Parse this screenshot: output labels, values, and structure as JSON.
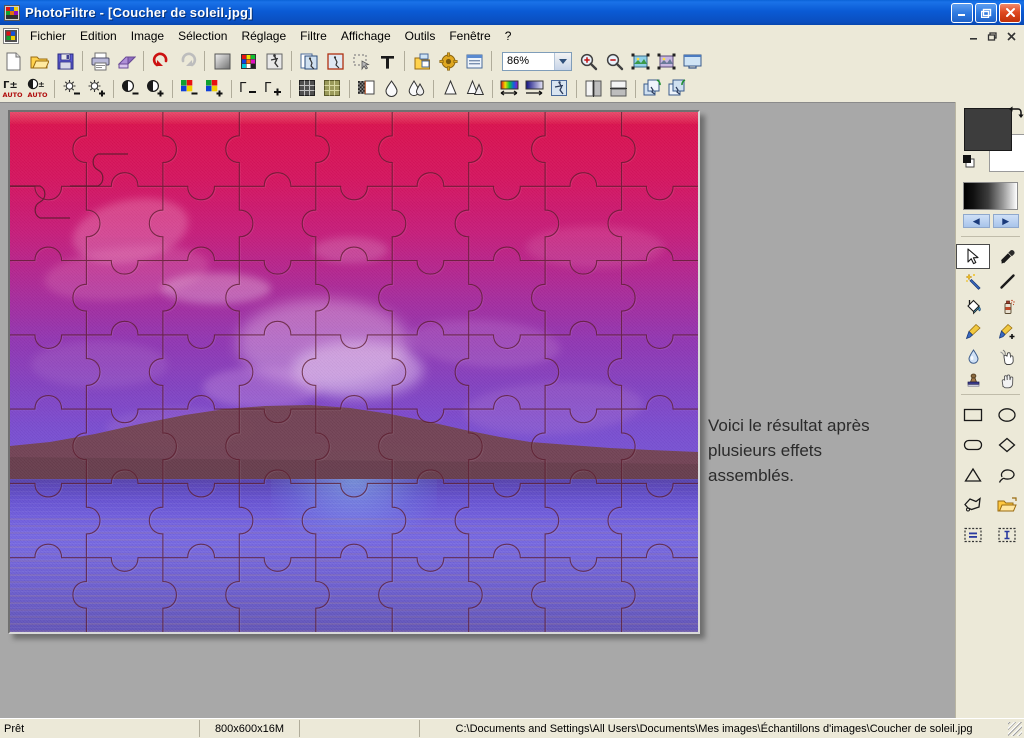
{
  "window": {
    "app_name": "PhotoFiltre",
    "document_name": "Coucher de soleil.jpg",
    "title": "PhotoFiltre - [Coucher de soleil.jpg]",
    "title_icon": "photofiltre-logo-icon",
    "controls": {
      "minimize": "–",
      "maximize": "❐",
      "close": "✕"
    },
    "mdi_controls": {
      "minimize": "–",
      "restore": "❐",
      "close": "✕"
    }
  },
  "menubar": {
    "doc_icon": "document-icon",
    "items": [
      {
        "label": "Fichier",
        "name": "menu-fichier"
      },
      {
        "label": "Edition",
        "name": "menu-edition"
      },
      {
        "label": "Image",
        "name": "menu-image"
      },
      {
        "label": "Sélection",
        "name": "menu-selection"
      },
      {
        "label": "Réglage",
        "name": "menu-reglage"
      },
      {
        "label": "Filtre",
        "name": "menu-filtre"
      },
      {
        "label": "Affichage",
        "name": "menu-affichage"
      },
      {
        "label": "Outils",
        "name": "menu-outils"
      },
      {
        "label": "Fenêtre",
        "name": "menu-fenetre"
      },
      {
        "label": "?",
        "name": "menu-aide"
      }
    ]
  },
  "toolbar_main": {
    "zoom_value": "86%",
    "buttons": [
      {
        "name": "new-file-icon",
        "tooltip": "Nouveau"
      },
      {
        "name": "open-file-icon",
        "tooltip": "Ouvrir"
      },
      {
        "name": "save-file-icon",
        "tooltip": "Enregistrer"
      },
      {
        "name": "print-icon",
        "tooltip": "Imprimer"
      },
      {
        "name": "print-preview-icon",
        "tooltip": "Aperçu"
      },
      {
        "name": "undo-icon",
        "tooltip": "Annuler"
      },
      {
        "name": "redo-icon",
        "tooltip": "Rétablir"
      },
      {
        "name": "grayscale-icon",
        "tooltip": "Niveaux de gris"
      },
      {
        "name": "color-palette-icon",
        "tooltip": "Couleurs"
      },
      {
        "name": "effect-icon",
        "tooltip": "Effet"
      },
      {
        "name": "copy-image-icon",
        "tooltip": "Copier"
      },
      {
        "name": "paste-image-icon",
        "tooltip": "Coller"
      },
      {
        "name": "selection-icon",
        "tooltip": "Sélection"
      },
      {
        "name": "text-tool-icon",
        "tooltip": "Texte"
      },
      {
        "name": "layers-icon",
        "tooltip": "Calques"
      },
      {
        "name": "gear-settings-icon",
        "tooltip": "Options"
      },
      {
        "name": "window-list-icon",
        "tooltip": "Fenêtres"
      },
      {
        "name": "zoom-in-icon",
        "tooltip": "Zoom avant"
      },
      {
        "name": "zoom-out-icon",
        "tooltip": "Zoom arrière"
      },
      {
        "name": "fit-image-icon",
        "tooltip": "Taille réelle"
      },
      {
        "name": "fit-window-icon",
        "tooltip": "Ajuster"
      },
      {
        "name": "fullscreen-icon",
        "tooltip": "Plein écran"
      }
    ]
  },
  "toolbar_filters": {
    "buttons": [
      {
        "name": "auto-contrast-icon",
        "label": "Γ±",
        "sub": "AUTO"
      },
      {
        "name": "auto-levels-icon",
        "label": "◐±",
        "sub": "AUTO"
      },
      {
        "name": "brightness-down-icon"
      },
      {
        "name": "brightness-up-icon"
      },
      {
        "name": "contrast-down-icon"
      },
      {
        "name": "contrast-up-icon"
      },
      {
        "name": "saturation-down-icon"
      },
      {
        "name": "saturation-up-icon"
      },
      {
        "name": "gamma-down-icon"
      },
      {
        "name": "gamma-up-icon"
      },
      {
        "name": "dither-grid-icon"
      },
      {
        "name": "texture-grid-icon"
      },
      {
        "name": "split-compare-icon"
      },
      {
        "name": "blur-icon"
      },
      {
        "name": "blur-more-icon"
      },
      {
        "name": "sharpen-icon"
      },
      {
        "name": "sharpen-more-icon"
      },
      {
        "name": "gradient-spectrum-icon"
      },
      {
        "name": "gradient-blue-icon"
      },
      {
        "name": "distort-icon"
      },
      {
        "name": "flip-horizontal-icon"
      },
      {
        "name": "flip-vertical-icon"
      },
      {
        "name": "rotate-left-icon"
      },
      {
        "name": "rotate-right-icon"
      }
    ]
  },
  "canvas": {
    "annotation": "Voici le résultat après\nplusieurs effets\nassemblés.",
    "image_alt": "Coucher de soleil avec effet puzzle",
    "effect": "puzzle"
  },
  "palette": {
    "foreground_color": "#3d3d3d",
    "background_color": "#ffffff",
    "swap_icon": "swap-colors-icon",
    "reset_icon": "reset-colors-icon",
    "gradient_bar": "grayscale-gradient",
    "nav_prev": "◀",
    "nav_next": "▶",
    "tools": [
      {
        "name": "select-arrow-tool",
        "selected": true
      },
      {
        "name": "eyedropper-tool",
        "selected": false
      },
      {
        "name": "magic-wand-tool",
        "selected": false
      },
      {
        "name": "line-tool",
        "selected": false
      },
      {
        "name": "paint-bucket-tool",
        "selected": false
      },
      {
        "name": "spray-can-tool",
        "selected": false
      },
      {
        "name": "paintbrush-tool",
        "selected": false
      },
      {
        "name": "paintbrush-plus-tool",
        "selected": false
      },
      {
        "name": "blur-droplet-tool",
        "selected": false
      },
      {
        "name": "smudge-finger-tool",
        "selected": false
      },
      {
        "name": "clone-stamp-tool",
        "selected": false
      },
      {
        "name": "hand-pan-tool",
        "selected": false
      }
    ],
    "shapes": [
      {
        "name": "rectangle-shape"
      },
      {
        "name": "ellipse-shape"
      },
      {
        "name": "rounded-rectangle-shape"
      },
      {
        "name": "diamond-shape"
      },
      {
        "name": "triangle-shape"
      },
      {
        "name": "lasso-shape"
      },
      {
        "name": "polygon-shape"
      },
      {
        "name": "open-folder-shape"
      },
      {
        "name": "selection-mode-equal-icon"
      },
      {
        "name": "selection-mode-text-icon"
      }
    ]
  },
  "statusbar": {
    "status": "Prêt",
    "dimensions": "800x600x16M",
    "extra": "",
    "file_path": "C:\\Documents and Settings\\All Users\\Documents\\Mes images\\Échantillons d'images\\Coucher de soleil.jpg"
  }
}
